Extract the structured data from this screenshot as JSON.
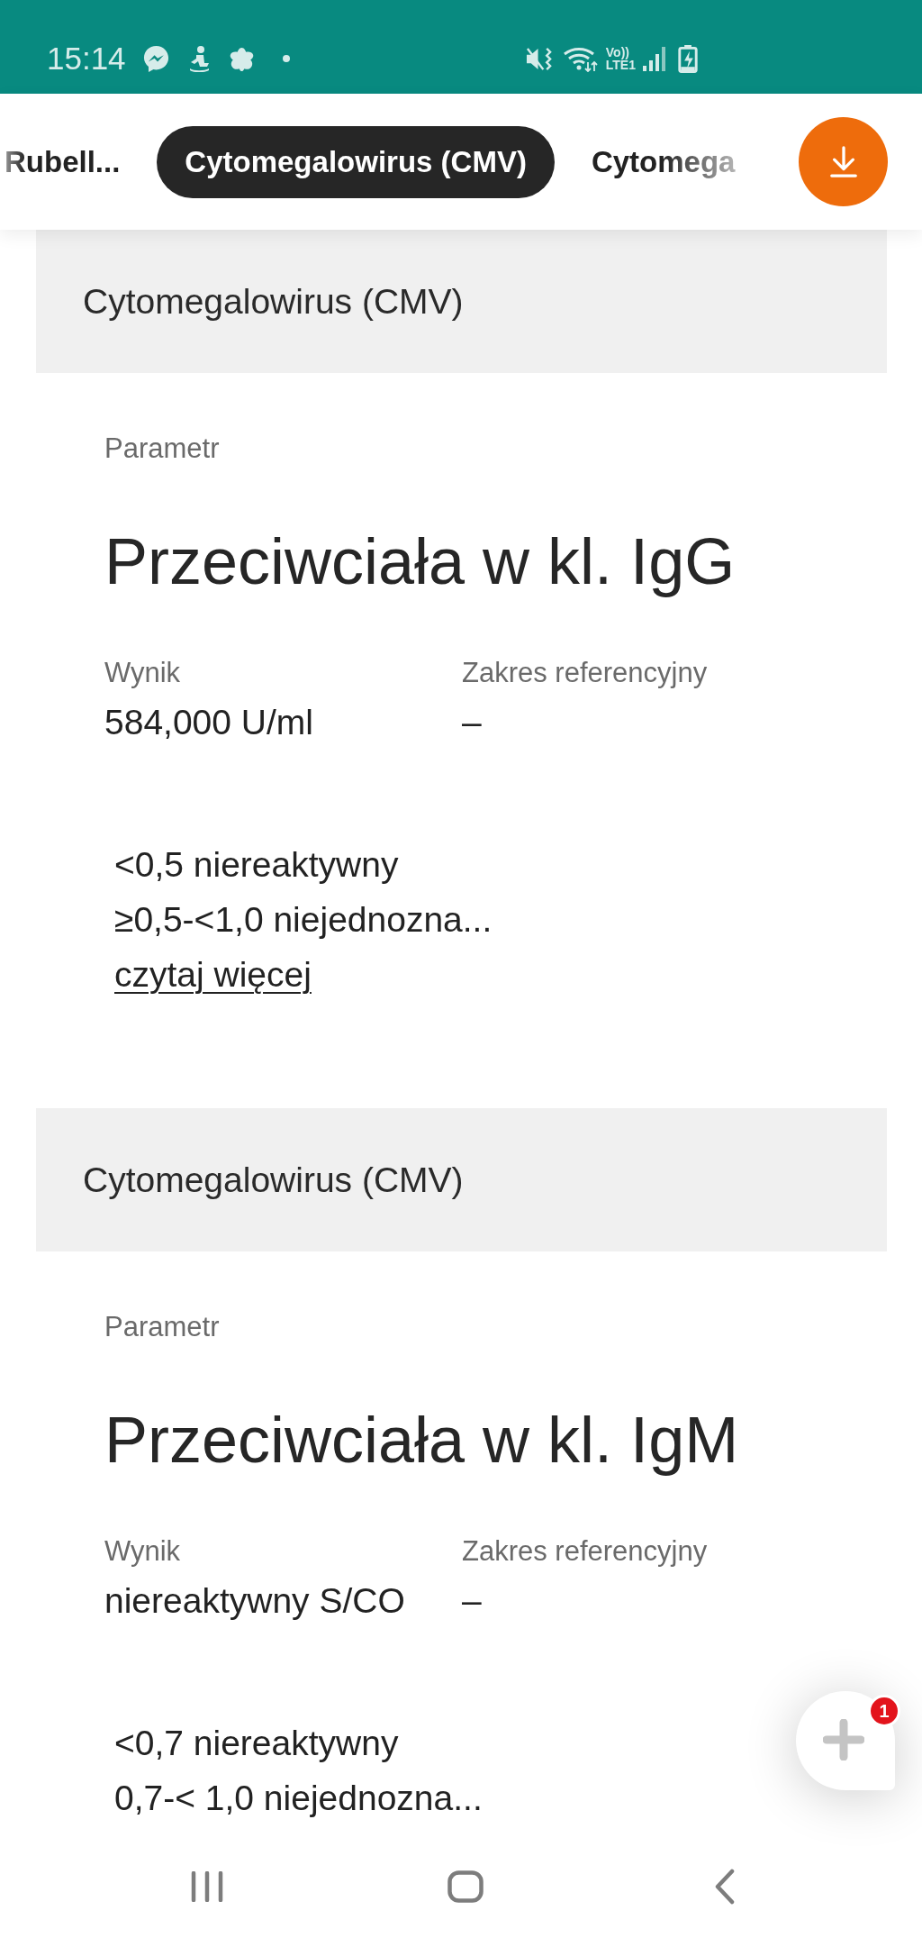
{
  "status_bar": {
    "time": "15:14",
    "volte_top": "Vo))",
    "volte_bottom": "LTE1"
  },
  "tabs": [
    {
      "label": "Rubell...",
      "selected": false
    },
    {
      "label": "Cytomegalowirus (CMV)",
      "selected": true
    },
    {
      "label": "Cytomega",
      "selected": false
    }
  ],
  "sections": [
    {
      "header": "Cytomegalowirus (CMV)",
      "parameter_label": "Parametr",
      "parameter": "Przeciwciała w kl. IgG",
      "result_label": "Wynik",
      "result": "584,000 U/ml",
      "range_label": "Zakres referencyjny",
      "range": "–",
      "reference_lines": [
        "<0,5 niereaktywny",
        "≥0,5-<1,0 niejednozna..."
      ],
      "more_link": "czytaj więcej"
    },
    {
      "header": "Cytomegalowirus (CMV)",
      "parameter_label": "Parametr",
      "parameter": "Przeciwciała w kl. IgM",
      "result_label": "Wynik",
      "result": "niereaktywny S/CO",
      "range_label": "Zakres referencyjny",
      "range": "–",
      "reference_lines": [
        "<0,7 niereaktywny",
        "0,7-< 1,0 niejednozna..."
      ]
    }
  ],
  "chat_button": {
    "badge": "1"
  }
}
